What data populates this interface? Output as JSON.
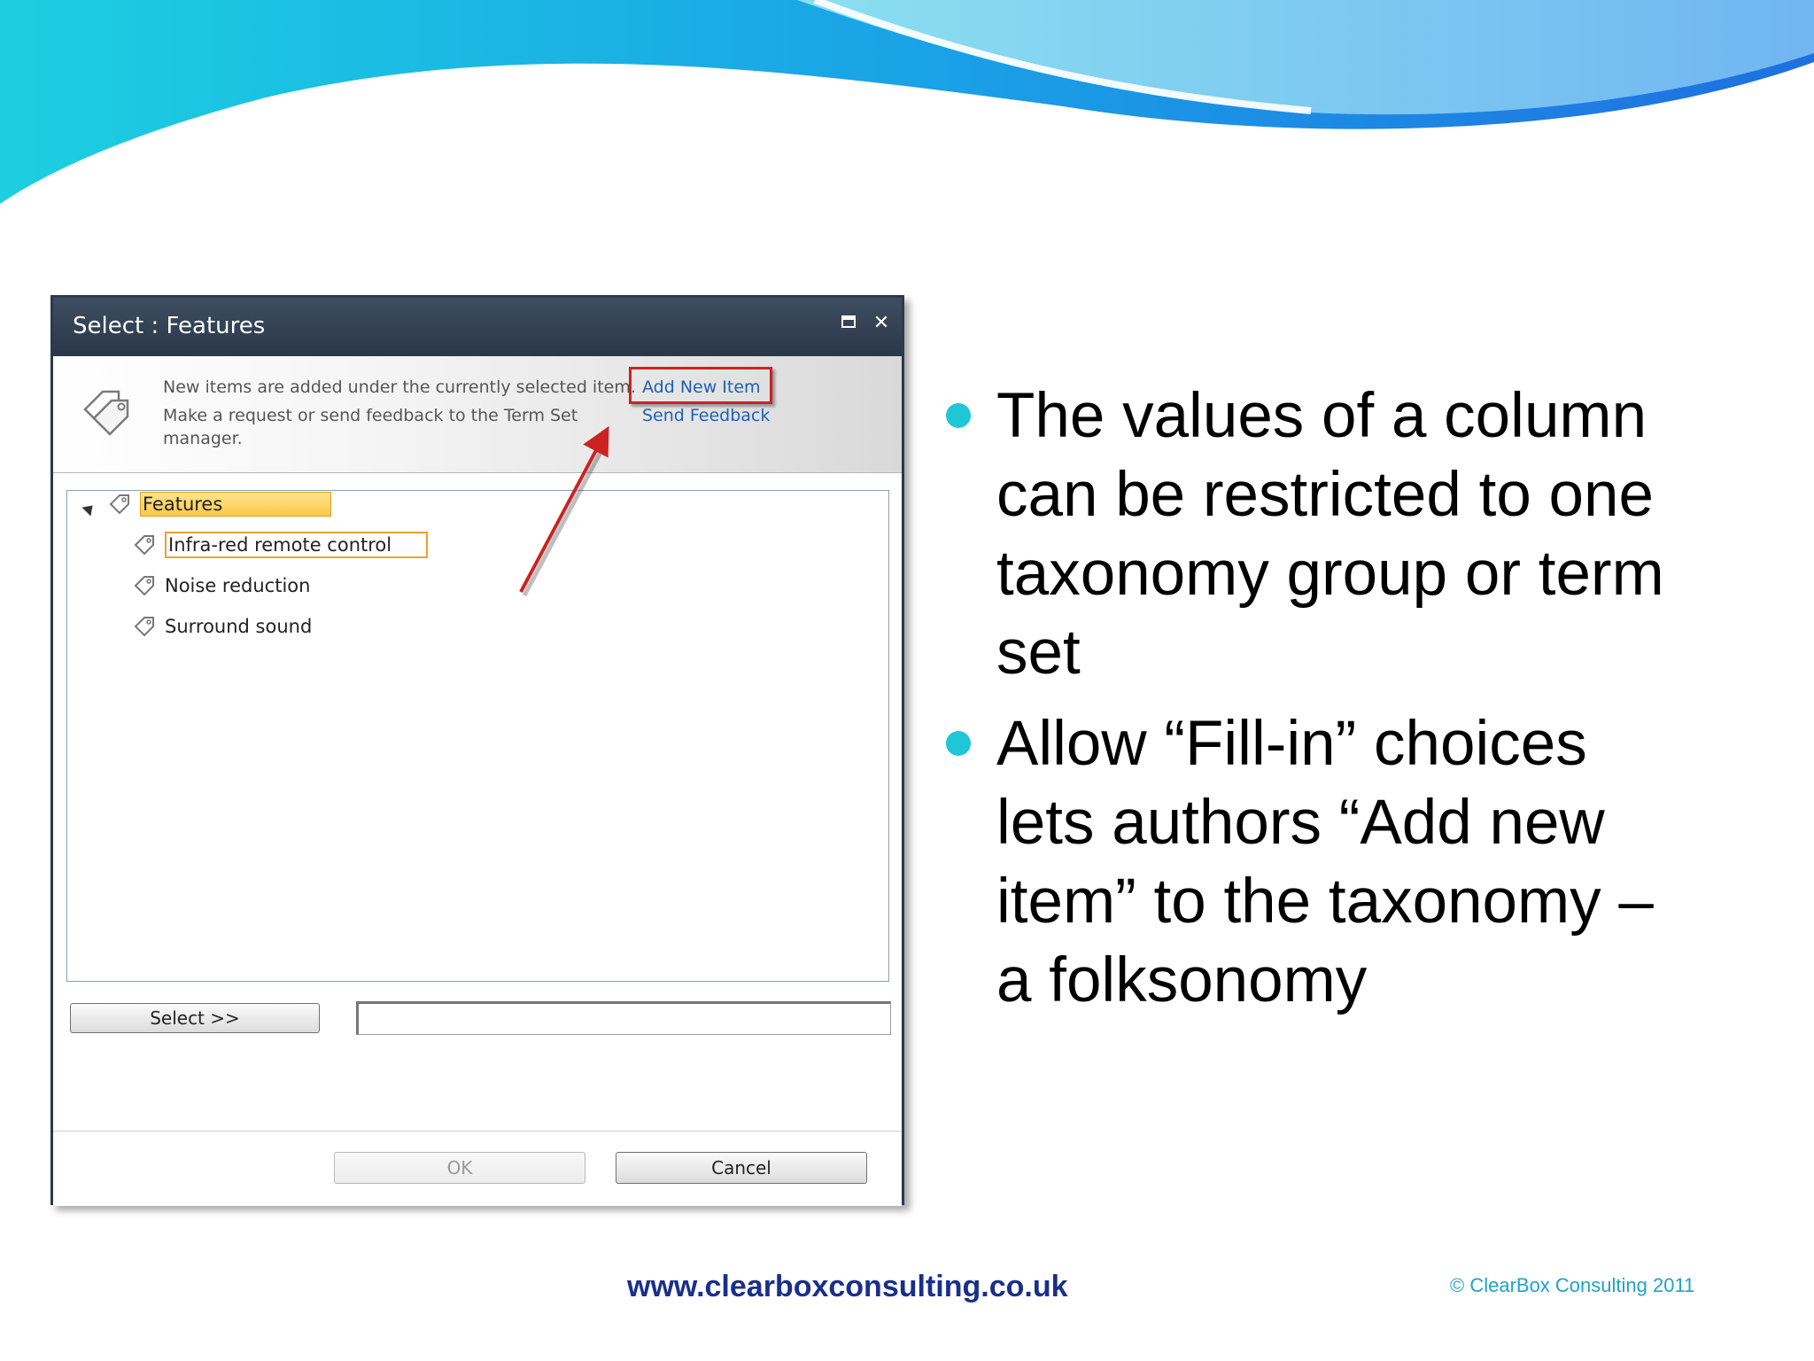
{
  "dialog": {
    "title": "Select : Features",
    "maximize_icon": "maximize-icon",
    "close_glyph": "✕",
    "info": {
      "line1": "New items are added under the currently selected item.",
      "line2": "Make a request or send feedback to the Term Set",
      "line3": "manager.",
      "add_new_item": "Add New Item",
      "send_feedback": "Send Feedback"
    },
    "tree": {
      "root": "Features",
      "children": [
        "Infra-red remote control",
        "Noise reduction",
        "Surround sound"
      ]
    },
    "select_button": "Select >>",
    "select_input_value": "",
    "ok_button": "OK",
    "cancel_button": "Cancel"
  },
  "bullets": {
    "item1": {
      "line1": "The values of a column",
      "line2": "can be restricted to one",
      "line3": "taxonomy group or term",
      "line4": "set"
    },
    "item2": {
      "line1": "Allow “Fill-in” choices",
      "line2": "lets authors  “Add new",
      "line3": "item” to the taxonomy –",
      "line4": "a folksonomy"
    }
  },
  "footer": {
    "url": "www.clearboxconsulting.co.uk",
    "copyright": "© ClearBox Consulting 2011"
  },
  "colors": {
    "accent": "#1fc6d8",
    "url": "#1a2f8c",
    "highlight": "#cc2222"
  }
}
